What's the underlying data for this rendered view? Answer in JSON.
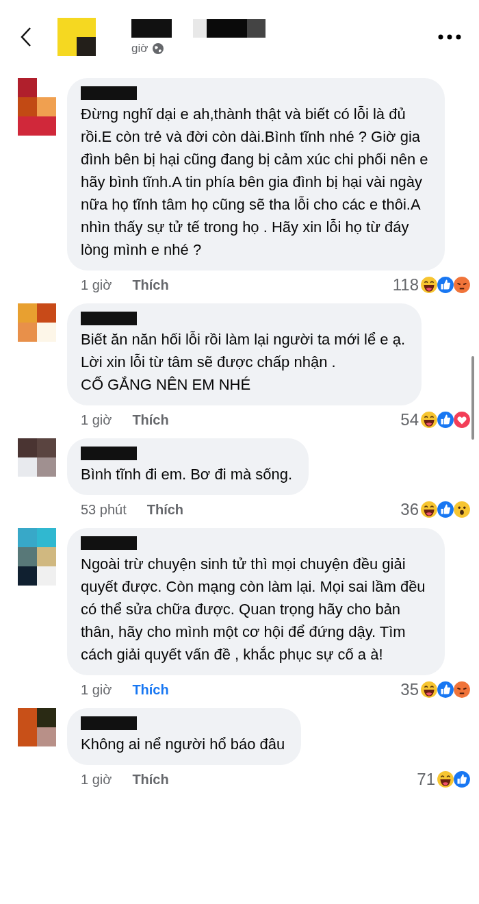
{
  "header": {
    "time": "giờ"
  },
  "comments": [
    {
      "text": "Đừng nghĩ dại e ah,thành thật và biết có lỗi là đủ rồi.E còn trẻ và đời còn dài.Bình tĩnh nhé ? Giờ gia đình bên bị hại cũng đang bị cảm xúc chi phối nên e hãy bình tĩnh.A tin phía bên gia đình bị hại vài ngày nữa họ tĩnh tâm họ cũng sẽ tha lỗi cho các e thôi.A nhìn thấy sự tử tế trong họ . Hãy xin lỗi họ từ đáy lòng mình e nhé ?",
      "time": "1 giờ",
      "like_label": "Thích",
      "liked": false,
      "count": "118",
      "reactions": [
        {
          "kind": "haha"
        },
        {
          "kind": "like"
        },
        {
          "kind": "angry"
        }
      ]
    },
    {
      "text": "Biết ăn năn hối lỗi rồi làm lại người ta mới lể e ạ.\nLời xin lỗi từ tâm sẽ được chấp nhận .\nCỐ GẮNG NÊN EM NHÉ",
      "time": "1 giờ",
      "like_label": "Thích",
      "liked": false,
      "count": "54",
      "reactions": [
        {
          "kind": "haha"
        },
        {
          "kind": "like"
        },
        {
          "kind": "love"
        }
      ]
    },
    {
      "text": "Bình tĩnh đi em. Bơ đi mà sống.",
      "time": "53 phút",
      "like_label": "Thích",
      "liked": false,
      "count": "36",
      "reactions": [
        {
          "kind": "haha"
        },
        {
          "kind": "like"
        },
        {
          "kind": "wow"
        }
      ]
    },
    {
      "text": "Ngoài trừ chuyện sinh tử thì mọi chuyện đều giải quyết được. Còn mạng còn làm lại. Mọi sai lầm đều có thể sửa chữa được. Quan trọng hãy cho bản thân, hãy cho mình một cơ hội để đứng dậy. Tìm cách giải quyết vấn đề , khắc phục sự cố a à!",
      "time": "1 giờ",
      "like_label": "Thích",
      "liked": true,
      "count": "35",
      "reactions": [
        {
          "kind": "haha"
        },
        {
          "kind": "like"
        },
        {
          "kind": "angry"
        }
      ]
    },
    {
      "text": "Không ai nể người hổ báo đâu",
      "time": "1 giờ",
      "like_label": "Thích",
      "liked": false,
      "count": "71",
      "reactions": [
        {
          "kind": "haha"
        },
        {
          "kind": "like"
        }
      ]
    }
  ]
}
